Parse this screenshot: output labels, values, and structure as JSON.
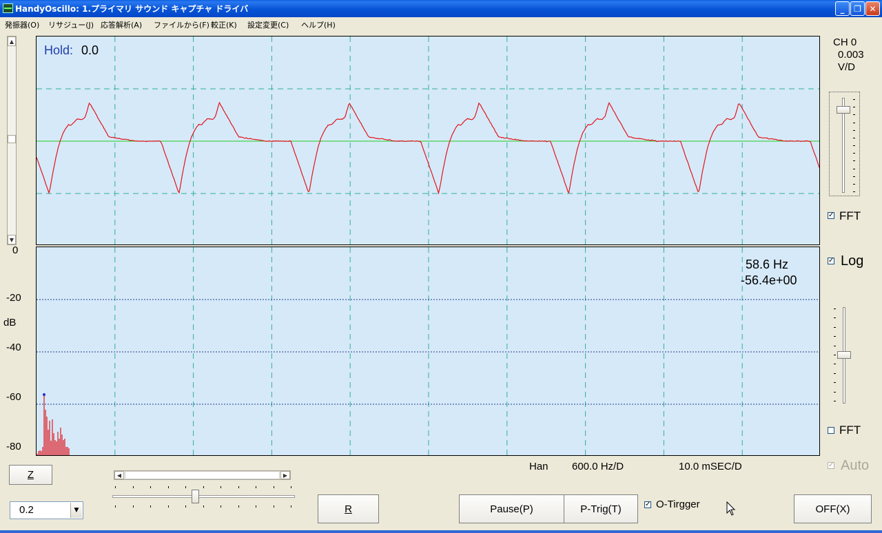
{
  "window": {
    "title": "HandyOscillo:  1.プライマリ サウンド キャプチャ ドライバ",
    "buttons": {
      "minimize": "_",
      "maximize": "❐",
      "close": "✕"
    }
  },
  "menu": [
    "発振器(O)",
    "リサジュー(J)",
    "応答解析(A)",
    "ファイルから(F)",
    "較正(K)",
    "設定変更(C)",
    "ヘルプ(H)"
  ],
  "scope": {
    "hold_label": "Hold:",
    "hold_value": "0.0",
    "channel": "CH 0",
    "volts": "0.003",
    "volts_unit": "V/D",
    "fft_top_label": "FFT",
    "fft_top_checked": true,
    "trace_color": "#e0151c",
    "baseline_color": "#1fcf1f",
    "grid_color": "#2fae9c"
  },
  "fft": {
    "log_label": "Log",
    "log_checked": true,
    "peak_freq": "58.6 Hz",
    "peak_level": "-56.4e+00",
    "y_ticks": [
      "0",
      "-20",
      "-40",
      "-60",
      "-80"
    ],
    "y_unit": "dB",
    "window_label": "Han",
    "freq_div": "600.0 Hz/D",
    "time_div": "10.0  mSEC/D",
    "fft_bottom_label": "FFT",
    "fft_bottom_checked": false,
    "auto_label": "Auto",
    "auto_checked": true
  },
  "controls": {
    "z_button": "Z",
    "zoom_select": "0.2",
    "r_button": "R",
    "pause_button": "Pause(P)",
    "ptrig_button": "P-Trig(T)",
    "otrigger_label": "O-Tirgger",
    "otrigger_checked": true,
    "off_button": "OFF(X)",
    "level_slider": 0.45
  }
}
